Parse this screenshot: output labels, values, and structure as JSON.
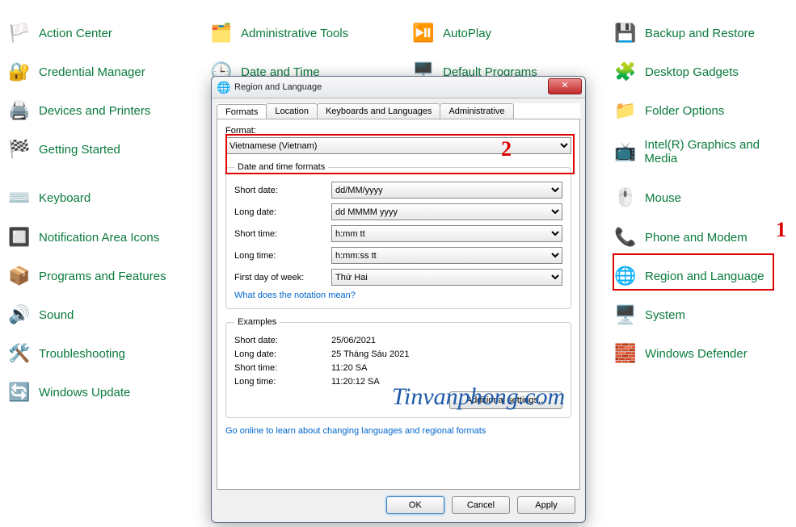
{
  "items": {
    "action_center": "Action Center",
    "admin_tools": "Administrative Tools",
    "autoplay": "AutoPlay",
    "backup": "Backup and Restore",
    "cred_mgr": "Credential Manager",
    "date_time": "Date and Time",
    "default_progs": "Default Programs",
    "gadgets": "Desktop Gadgets",
    "dev_print": "Devices and Printers",
    "folder_opts": "Folder Options",
    "getting_started": "Getting Started",
    "intel": "Intel(R) Graphics and Media",
    "keyboard": "Keyboard",
    "mouse": "Mouse",
    "notif": "Notification Area Icons",
    "phone": "Phone and Modem",
    "prog_feat": "Programs and Features",
    "region_lang_link": "Region and Language",
    "sound": "Sound",
    "system": "System",
    "trouble": "Troubleshooting",
    "defender": "Windows Defender",
    "update": "Windows Update"
  },
  "dialog": {
    "title": "Region and Language",
    "tabs": {
      "formats": "Formats",
      "location": "Location",
      "keylang": "Keyboards and Languages",
      "admin": "Administrative"
    },
    "format_label": "Format:",
    "format_value": "Vietnamese (Vietnam)",
    "dt_group": "Date and time formats",
    "short_date": "Short date:",
    "long_date": "Long date:",
    "short_time": "Short time:",
    "long_time": "Long time:",
    "first_day": "First day of week:",
    "short_date_val": "dd/MM/yyyy",
    "long_date_val": "dd MMMM yyyy",
    "short_time_val": "h:mm tt",
    "long_time_val": "h:mm:ss tt",
    "first_day_val": "Thứ Hai",
    "notation_link": "What does the notation mean?",
    "examples": "Examples",
    "ex_sd": "25/06/2021",
    "ex_ld": "25 Tháng Sáu 2021",
    "ex_st": "11:20 SA",
    "ex_lt": "11:20:12 SA",
    "additional": "Additional settings...",
    "online_link": "Go online to learn about changing languages and regional formats",
    "ok": "OK",
    "cancel": "Cancel",
    "apply": "Apply"
  },
  "annot": {
    "one": "1",
    "two": "2"
  },
  "watermark": "Tinvanphong.com"
}
